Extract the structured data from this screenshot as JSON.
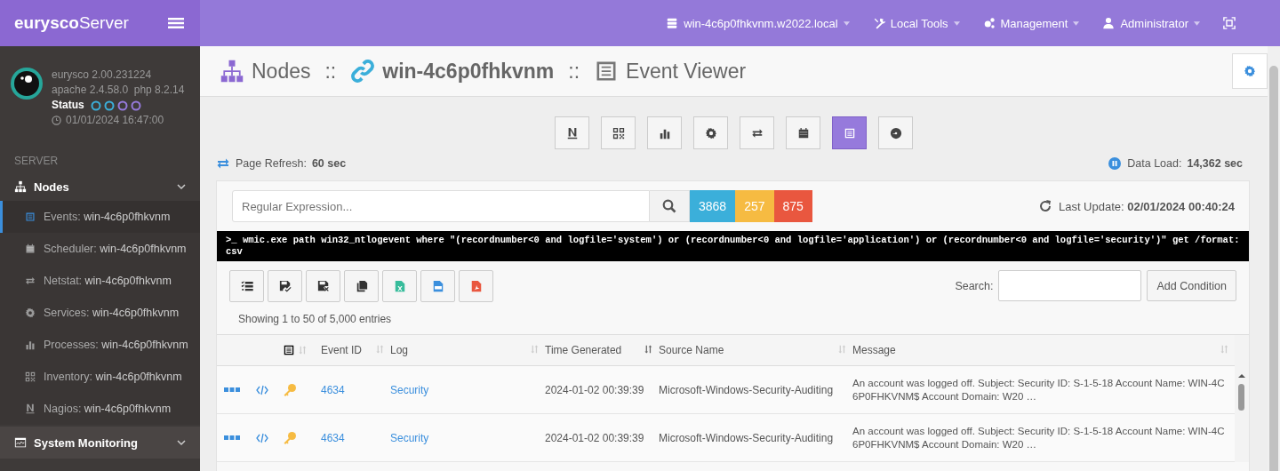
{
  "topbar": {
    "brand": "**eurysco**Server",
    "nav": [
      {
        "kind": "server",
        "label": "win-4c6p0fhkvnm.w2022.local"
      },
      {
        "kind": "tools",
        "label": "Local Tools"
      },
      {
        "kind": "gears",
        "label": "Management"
      },
      {
        "kind": "user",
        "label": "Administrator"
      }
    ]
  },
  "sidebar": {
    "version": "eurysco 2.00.231224",
    "stack": "apache 2.4.58.0  php 8.2.14",
    "status_label": "Status",
    "datetime": "01/01/2024 16:47:00",
    "section": "SERVER",
    "groups": [
      {
        "kind": "sitemap",
        "label": "Nodes",
        "expanded": true,
        "children": [
          {
            "kind": "list",
            "label": "Events: **win-4c6p0fhkvnm**",
            "selected": true
          },
          {
            "kind": "calendar",
            "label": "Scheduler: **win-4c6p0fhkvnm**",
            "selected": false
          },
          {
            "kind": "exchange",
            "label": "Netstat: **win-4c6p0fhkvnm**",
            "selected": false
          },
          {
            "kind": "gear",
            "label": "Services: **win-4c6p0fhkvnm**",
            "selected": false
          },
          {
            "kind": "bars",
            "label": "Processes: **win-4c6p0fhkvnm**",
            "selected": false
          },
          {
            "kind": "qr",
            "label": "Inventory: **win-4c6p0fhkvnm**",
            "selected": false
          },
          {
            "kind": "nagios",
            "label": "Nagios: **win-4c6p0fhkvnm**",
            "selected": false
          }
        ]
      },
      {
        "kind": "monitor",
        "label": "System Monitoring",
        "expanded": true
      }
    ]
  },
  "header": {
    "crumbs": [
      {
        "kind": "sitemap",
        "label": "Nodes",
        "sep": "::"
      },
      {
        "kind": "link",
        "label": "win-4c6p0fhkvnm",
        "sep": "::"
      },
      {
        "kind": "list",
        "label": "Event Viewer"
      }
    ]
  },
  "tools": [
    {
      "kind": "nagios",
      "selected": false
    },
    {
      "kind": "qr",
      "selected": false
    },
    {
      "kind": "bars",
      "selected": false
    },
    {
      "kind": "gear",
      "selected": false
    },
    {
      "kind": "exchange",
      "selected": false
    },
    {
      "kind": "calendar",
      "selected": false
    },
    {
      "kind": "list",
      "selected": true
    },
    {
      "kind": "disc",
      "selected": false
    }
  ],
  "page_refresh": {
    "label": "Page Refresh:",
    "value": "60 sec"
  },
  "data_load": {
    "label": "Data Load:",
    "value": "14,362 sec"
  },
  "card": {
    "placeholder": "Regular Expression...",
    "badges": [
      {
        "text": "3868",
        "color": "#3bafda"
      },
      {
        "text": "257",
        "color": "#f6bb42"
      },
      {
        "text": "875",
        "color": "#e9573f"
      }
    ],
    "last_update": {
      "label": "Last Update:",
      "value": "02/01/2024 00:40:24"
    },
    "command": {
      "prompt": ">_",
      "text": "wmic.exe path win32_ntlogevent where \"(recordnumber<0 and logfile='system') or (recordnumber<0 and logfile='application') or (recordnumber<0 and logfile='security')\" get /format:csv"
    },
    "exports": [
      {
        "kind": "checklist"
      },
      {
        "kind": "save-check"
      },
      {
        "kind": "save-x"
      },
      {
        "kind": "copy"
      },
      {
        "kind": "excel"
      },
      {
        "kind": "csv"
      },
      {
        "kind": "pdf"
      }
    ],
    "search_label": "Search:",
    "add_condition": "Add Condition",
    "info": "Showing 1 to 50 of 5,000 entries",
    "columns": [
      {
        "label": "Event ID",
        "sorted": false
      },
      {
        "label": "Log",
        "sorted": false
      },
      {
        "label": "Time Generated",
        "sorted": true
      },
      {
        "label": "Source Name",
        "sorted": false
      },
      {
        "label": "Message",
        "sorted": false
      }
    ],
    "rows": [
      {
        "event_id": "4634",
        "log": "Security",
        "time": "2024-01-02 00:39:39",
        "source": "Microsoft-Windows-Security-Auditing",
        "message": "An account was logged off. Subject: Security ID: S-1-5-18 Account Name: WIN-4C6P0FHKVNM$ Account Domain: W20 …"
      },
      {
        "event_id": "4634",
        "log": "Security",
        "time": "2024-01-02 00:39:39",
        "source": "Microsoft-Windows-Security-Auditing",
        "message": "An account was logged off. Subject: Security ID: S-1-5-18 Account Name: WIN-4C6P0FHKVNM$ Account Domain: W20 …"
      }
    ]
  }
}
